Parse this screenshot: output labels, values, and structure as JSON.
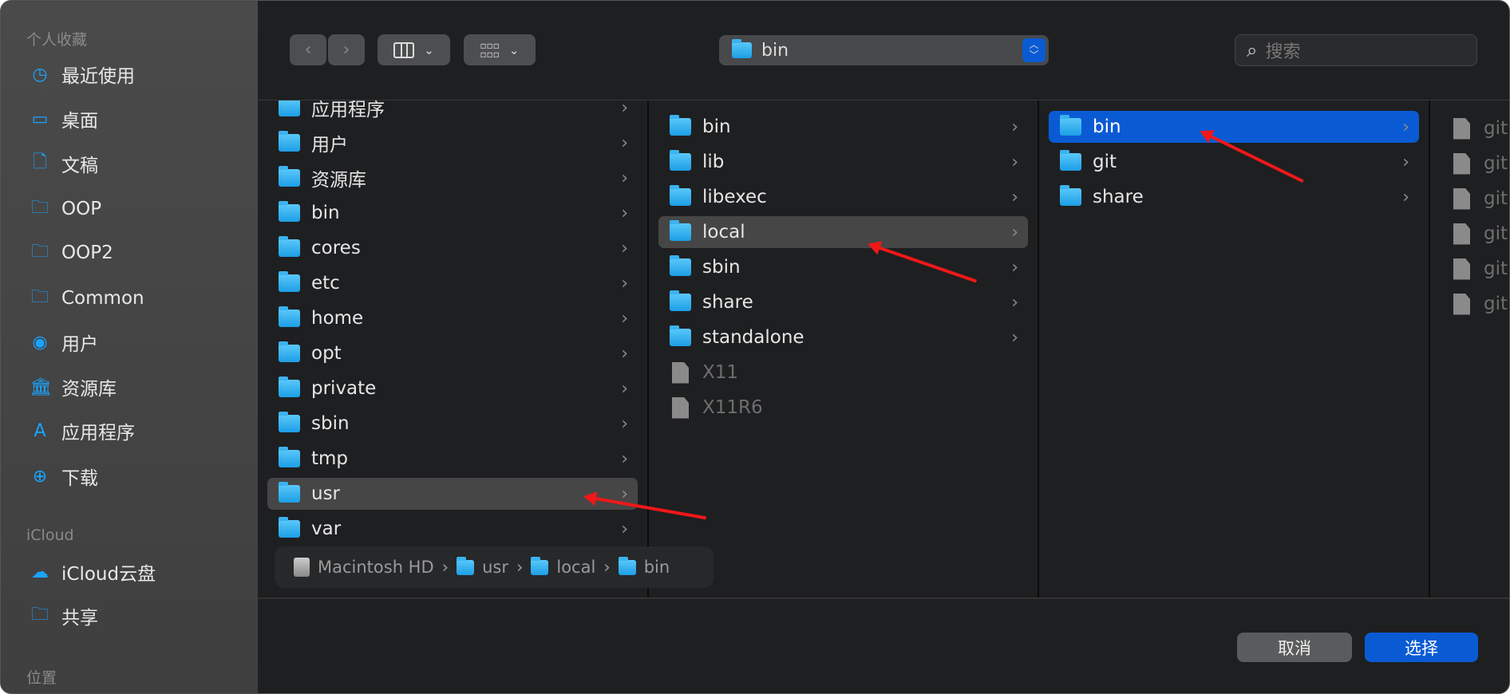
{
  "sidebar": {
    "favorites_header": "个人收藏",
    "favorites": [
      {
        "label": "最近使用",
        "icon": "clock-icon"
      },
      {
        "label": "桌面",
        "icon": "desktop-icon"
      },
      {
        "label": "文稿",
        "icon": "document-icon"
      },
      {
        "label": "OOP",
        "icon": "folder-icon"
      },
      {
        "label": "OOP2",
        "icon": "folder-icon"
      },
      {
        "label": "Common",
        "icon": "folder-icon"
      },
      {
        "label": "用户",
        "icon": "user-icon"
      },
      {
        "label": "资源库",
        "icon": "library-icon"
      },
      {
        "label": "应用程序",
        "icon": "applications-icon"
      },
      {
        "label": "下载",
        "icon": "download-icon"
      }
    ],
    "icloud_header": "iCloud",
    "icloud": [
      {
        "label": "iCloud云盘",
        "icon": "cloud-icon"
      },
      {
        "label": "共享",
        "icon": "shared-folder-icon"
      }
    ],
    "locations_header": "位置"
  },
  "toolbar": {
    "path_popup": "bin",
    "search_placeholder": "搜索"
  },
  "columns": [
    {
      "items": [
        "应用程序",
        "用户",
        "资源库",
        "bin",
        "cores",
        "etc",
        "home",
        "opt",
        "private",
        "sbin",
        "tmp",
        "usr",
        "var"
      ],
      "highlighted": "usr"
    },
    {
      "items": [
        "bin",
        "lib",
        "libexec",
        "local",
        "sbin",
        "share",
        "standalone",
        "X11",
        "X11R6"
      ],
      "highlighted": "local",
      "disabled": [
        "X11",
        "X11R6"
      ]
    },
    {
      "items": [
        "bin",
        "git",
        "share"
      ],
      "selected": "bin"
    },
    {
      "items": [
        "git",
        "git",
        "git",
        "git",
        "git",
        "git"
      ]
    }
  ],
  "breadcrumb": [
    "Macintosh HD",
    "usr",
    "local",
    "bin"
  ],
  "buttons": {
    "cancel": "取消",
    "choose": "选择"
  },
  "colors": {
    "accent": "#0a5bd3",
    "folder": "#1c9ee6",
    "annotation_arrow": "#f01818"
  }
}
